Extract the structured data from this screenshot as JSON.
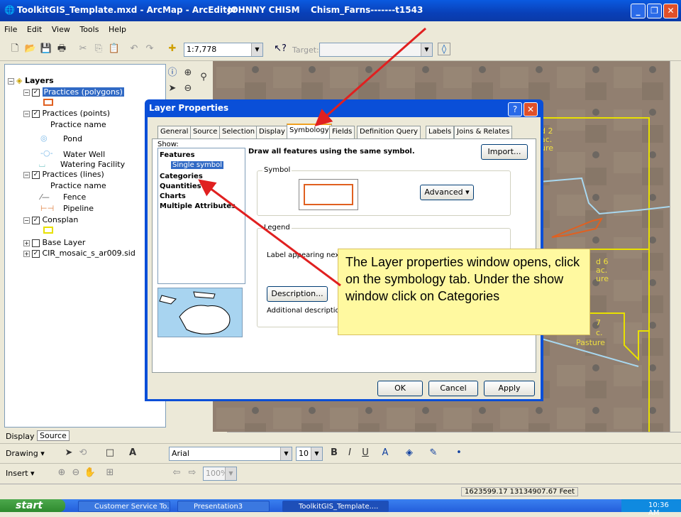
{
  "window": {
    "title": "ToolkitGIS_Template.mxd - ArcMap - ArcEditor",
    "user": "JOHNNY CHISM",
    "farm": "Chism_Farns-------t1543"
  },
  "menu": [
    "File",
    "Edit",
    "View",
    "Tools",
    "Help"
  ],
  "toolbar": {
    "scale": "1:7,778",
    "target_label": "Target:"
  },
  "toc": {
    "title": "Layers",
    "items": [
      {
        "label": "Practices (polygons)",
        "selected": true
      },
      {
        "label": "Practices (points)"
      },
      {
        "label": "Practice name"
      },
      {
        "label": "Pond"
      },
      {
        "label": "Water Well"
      },
      {
        "label": "Watering Facility"
      },
      {
        "label": "Practices (lines)"
      },
      {
        "label": "Practice name"
      },
      {
        "label": "Fence"
      },
      {
        "label": "Pipeline"
      },
      {
        "label": "Consplan"
      },
      {
        "label": "Base Layer"
      },
      {
        "label": "CIR_mosaic_s_ar009.sid"
      }
    ],
    "tabs": [
      "Display",
      "Source"
    ]
  },
  "dialog": {
    "title": "Layer Properties",
    "tabs": [
      "General",
      "Source",
      "Selection",
      "Display",
      "Symbology",
      "Fields",
      "Definition Query",
      "Labels",
      "Joins & Relates"
    ],
    "show_label": "Show:",
    "show_items": [
      "Features",
      "Single symbol",
      "Categories",
      "Quantities",
      "Charts",
      "Multiple Attributes"
    ],
    "heading": "Draw all features using the same symbol.",
    "import_label": "Import...",
    "symbol_label": "Symbol",
    "advanced_label": "Advanced",
    "legend_label": "Legend",
    "legend_text": "Label appearing next t",
    "description_label": "Description...",
    "additional_text": "Additional description a",
    "ok": "OK",
    "cancel": "Cancel",
    "apply": "Apply"
  },
  "callout": "The Layer properties window opens, click on the symbology tab. Under the show window click on Categories",
  "map_labels": [
    "d 2",
    "ac.",
    "ure",
    "d 6",
    "ac.",
    "ure",
    "7",
    "c.",
    "Pasture"
  ],
  "drawbar": {
    "drawing": "Drawing",
    "font": "Arial",
    "size": "10"
  },
  "insertbar": {
    "insert": "Insert",
    "zoom": "100%"
  },
  "status": {
    "coords": "1623599.17  13134907.67 Feet"
  },
  "taskbar": {
    "start": "start",
    "tasks": [
      "Customer Service To...",
      "Presentation3",
      "ToolkitGIS_Template...."
    ],
    "clock": "10:36 AM"
  },
  "colors": {
    "accent": "#0a5ae0",
    "annotation_arrow": "#e02020",
    "callout_bg": "#fff9a0",
    "polygon_outline": "#e06020"
  }
}
